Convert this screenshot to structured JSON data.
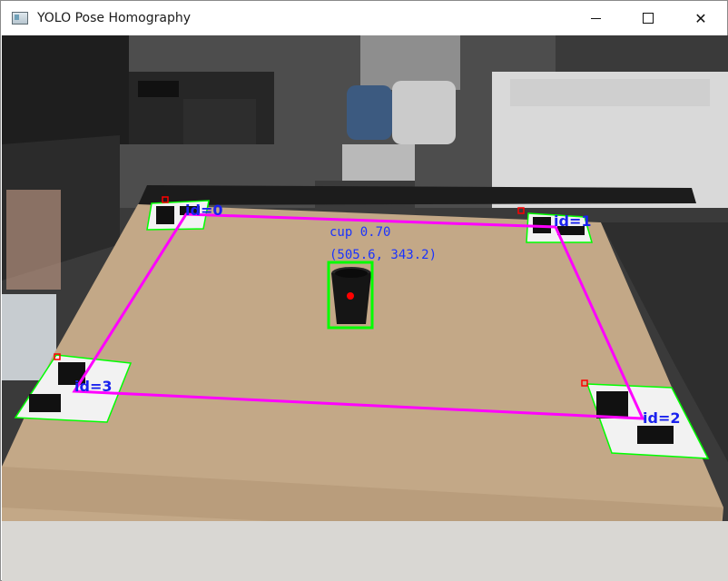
{
  "window": {
    "title": "YOLO Pose Homography",
    "icon": "app-window-icon",
    "controls": {
      "minimize": "minimize-icon",
      "maximize": "maximize-icon",
      "close": "close-icon"
    }
  },
  "detection": {
    "label": "cup 0.70",
    "coords": "(505.6, 343.2)",
    "box_color": "#00ff00",
    "center_color": "#ff0000",
    "text_color": "#1a33ff"
  },
  "markers": [
    {
      "label": "id=0"
    },
    {
      "label": "id=1"
    },
    {
      "label": "id=2"
    },
    {
      "label": "id=3"
    }
  ],
  "overlay_colors": {
    "workspace_polygon": "#ff00ff",
    "marker_outline": "#00ff00",
    "corner_point": "#ff0000"
  }
}
